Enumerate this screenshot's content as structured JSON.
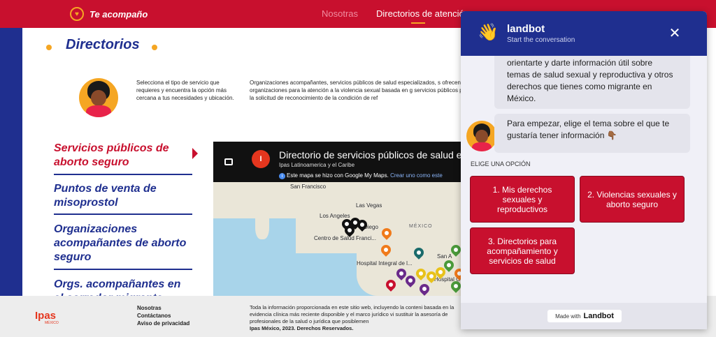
{
  "header": {
    "brand": "Te acompaño",
    "nav": [
      {
        "label": "Nosotras"
      },
      {
        "label": "Directorios de atención"
      }
    ]
  },
  "page": {
    "title": "Directorios",
    "intro_left": "Selecciona el tipo de servicio que requieres y encuentra la opción más cercana a tus necesidades y ubicación.",
    "intro_right": "Organizaciones acompañantes, servicios públicos de salud especializados, s ofrecen las organizaciones para la atención a la violencia sexual basada en g servicios públicos para la solicitud de reconocimiento de la condición de ref"
  },
  "menu": [
    {
      "label": "Servicios públicos de aborto seguro",
      "active": true
    },
    {
      "label": "Puntos de venta de misoprostol"
    },
    {
      "label": "Organizaciones acompañantes de aborto seguro"
    },
    {
      "label": "Orgs. acompañantes en el corredor migrante"
    }
  ],
  "map": {
    "title": "Directorio de servicios públicos de salud esp",
    "subtitle": "Ipas Latinoamerica y el Caribe",
    "note": "Este mapa se hizo con Google My Maps.",
    "note_link": "Crear uno como este",
    "labels": {
      "sf": "San Francisco",
      "lv": "Las Vegas",
      "la": "Los Angeles",
      "sd": "Diego",
      "mexico": "MÉXICO",
      "csf": "Centro de Salud Franci...",
      "hi": "Hospital Integral de l...",
      "san": "San A",
      "hg": "Hospital Genera"
    }
  },
  "footer": {
    "logo": "Ipas",
    "logo_sub": "MÉXICO",
    "links": [
      "Nosotras",
      "Contáctanos",
      "Aviso de privacidad"
    ],
    "text": "Toda la información proporcionada en este sitio web, incluyendo la conteni basada en la evidencia clínica más reciente disponible y el marco jurídico vi sustituir la asesoría de profesionales de la salud o jurídica que posiblemen",
    "rights": "Ipas México, 2023. Derechos Reservados."
  },
  "chat": {
    "name": "landbot",
    "status": "Start the conversation",
    "message1": "orientarte y darte información útil sobre temas de salud sexual y reproductiva y otros derechos que tienes como migrante en México.",
    "message2": "Para empezar, elige el tema sobre el que te gustaría tener información 👇🏾",
    "options_label": "ELIGE UNA OPCIÓN",
    "options": [
      "1. Mis derechos sexuales y reproductivos",
      "2. Violencias sexuales y aborto seguro",
      "3. Directorios para acompañamiento y servicios de salud"
    ],
    "made_with": "Made with",
    "made_brand": "Landbot"
  },
  "colors": {
    "primary_red": "#c8102e",
    "primary_blue": "#1f2f8f",
    "accent_orange": "#f5a623"
  }
}
